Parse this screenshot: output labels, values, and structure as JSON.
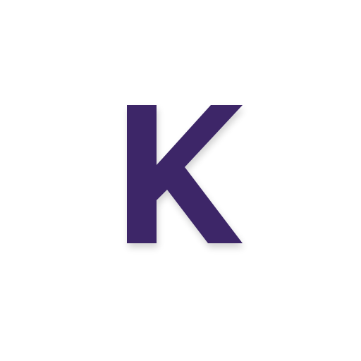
{
  "logo": {
    "letter": "K",
    "color": "#3c2867",
    "background": "#ffffff"
  }
}
